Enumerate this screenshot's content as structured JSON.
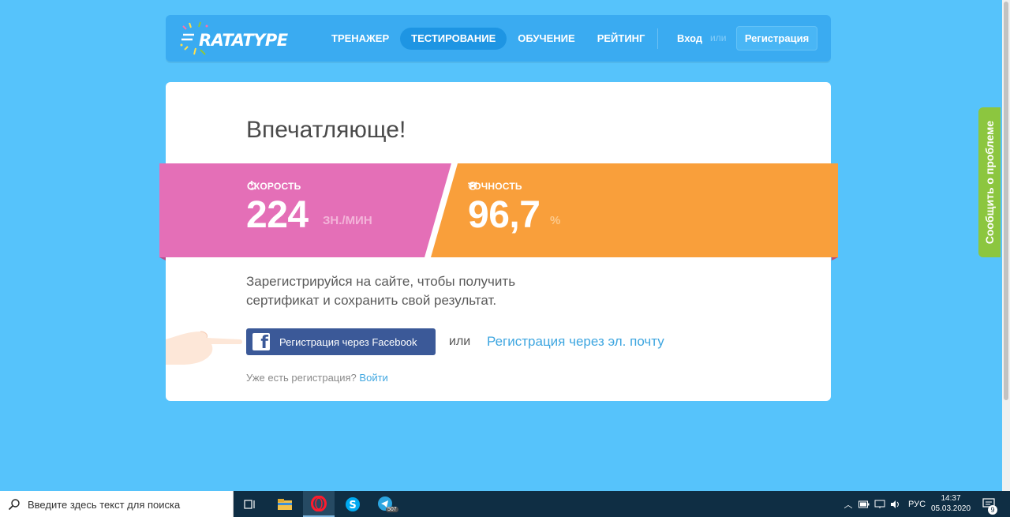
{
  "header": {
    "logo_text": "RATATYPE",
    "nav": [
      {
        "label": "ТРЕНАЖЕР",
        "active": false
      },
      {
        "label": "ТЕСТИРОВАНИЕ",
        "active": true
      },
      {
        "label": "ОБУЧЕНИЕ",
        "active": false
      },
      {
        "label": "РЕЙТИНГ",
        "active": false
      }
    ],
    "login_label": "Вход",
    "or_label": "или",
    "register_label": "Регистрация"
  },
  "result": {
    "title": "Впечатляюще!",
    "speed": {
      "label": "СКОРОСТЬ",
      "value": "224",
      "unit": "ЗН./МИН",
      "icon": "stopwatch-icon",
      "color": "#e46fb7"
    },
    "accuracy": {
      "label": "ТОЧНОСТЬ",
      "value": "96,7",
      "unit": "%",
      "icon": "target-icon",
      "color": "#f99f3b"
    }
  },
  "signup": {
    "promo_line1": "Зарегистрируйся на сайте, чтобы получить",
    "promo_line2": "сертификат и сохранить свой результат.",
    "facebook_label": "Регистрация через Facebook",
    "or_label": "или",
    "email_label": "Регистрация через эл. почту",
    "already_text": "Уже есть регистрация?",
    "login_link": "Войти"
  },
  "feedback_tab": "Сообщить о проблеме",
  "taskbar": {
    "search_placeholder": "Введите здесь текст для поиска",
    "lang": "РУС",
    "time": "14:37",
    "date": "05.03.2020",
    "notification_count": "9",
    "telegram_badge": "507"
  },
  "colors": {
    "page_bg": "#56c3fb",
    "header_bg": "#3aabf1",
    "speed_bg": "#e46fb7",
    "accuracy_bg": "#f99f3b",
    "facebook": "#3b5998",
    "link": "#3ea6e0",
    "feedback": "#8cc63f"
  }
}
